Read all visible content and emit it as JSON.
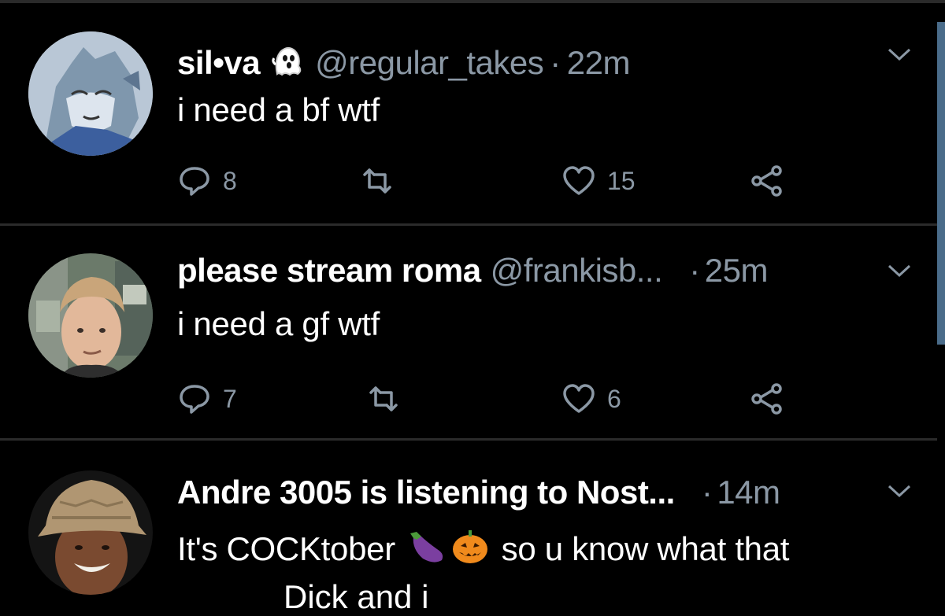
{
  "colors": {
    "background": "#000000",
    "text_primary": "#ffffff",
    "text_secondary": "#8b98a5",
    "divider": "#2b2b2b",
    "scroll_indicator": "#4a6c8a"
  },
  "tweets": [
    {
      "name": "sil•va",
      "name_badge_icon": "ghost-icon",
      "handle": "@regular_takes",
      "separator": "·",
      "time": "22m",
      "text": "i need a bf wtf",
      "replies": "8",
      "likes": "15"
    },
    {
      "name": "please stream roma",
      "handle": "@frankisb...",
      "separator": "·",
      "time": "25m",
      "text": "i need a gf wtf",
      "replies": "7",
      "likes": "6"
    },
    {
      "name": "Andre 3005 is listening to Nost...",
      "handle": "",
      "separator": "·",
      "time": "14m",
      "text_part1": "It's COCKtober",
      "emoji1": "eggplant-emoji",
      "emoji2": "jack-o-lantern-emoji",
      "text_part2": "so u know what that",
      "text_cut": "Dick and i"
    }
  ]
}
